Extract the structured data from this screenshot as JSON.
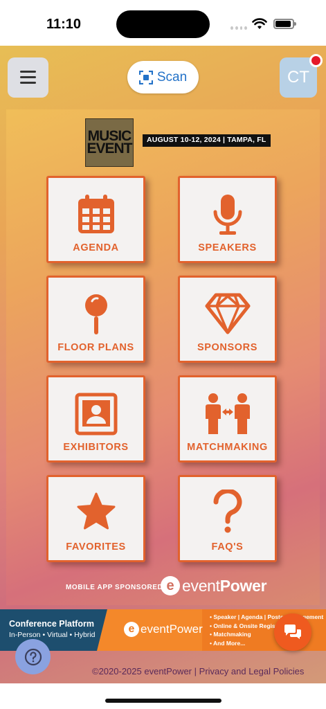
{
  "status_bar": {
    "time": "11:10"
  },
  "header": {
    "scan_label": "Scan",
    "avatar_initials": "CT"
  },
  "event": {
    "logo_line1": "MUSIC",
    "logo_line2": "EVENT",
    "dates_location": "AUGUST 10-12, 2024 | TAMPA, FL"
  },
  "tiles": [
    {
      "label": "AGENDA",
      "icon": "calendar-icon"
    },
    {
      "label": "SPEAKERS",
      "icon": "microphone-icon"
    },
    {
      "label": "FLOOR PLANS",
      "icon": "map-pin-icon"
    },
    {
      "label": "SPONSORS",
      "icon": "diamond-icon"
    },
    {
      "label": "EXHIBITORS",
      "icon": "portrait-icon"
    },
    {
      "label": "MATCHMAKING",
      "icon": "people-exchange-icon"
    },
    {
      "label": "FAVORITES",
      "icon": "star-icon"
    },
    {
      "label": "FAQ'S",
      "icon": "question-mark-icon"
    }
  ],
  "sponsor": {
    "label": "MOBILE APP SPONSORED BY:",
    "brand_prefix": "event",
    "brand_suffix": "Power"
  },
  "banner": {
    "title": "Conference Platform",
    "subtitle": "In-Person • Virtual • Hybrid",
    "brand": "eventPower",
    "items": [
      "• Speaker | Agenda | Poster Management",
      "• Online & Onsite Registration",
      "• Matchmaking",
      "• And More..."
    ]
  },
  "footer": {
    "copyright": "©2020-2025 eventPower",
    "separator": "|",
    "privacy_link": "Privacy and Legal Policies"
  },
  "colors": {
    "accent": "#e2622d",
    "scan_blue": "#2372c8",
    "notification": "#e5192a"
  }
}
